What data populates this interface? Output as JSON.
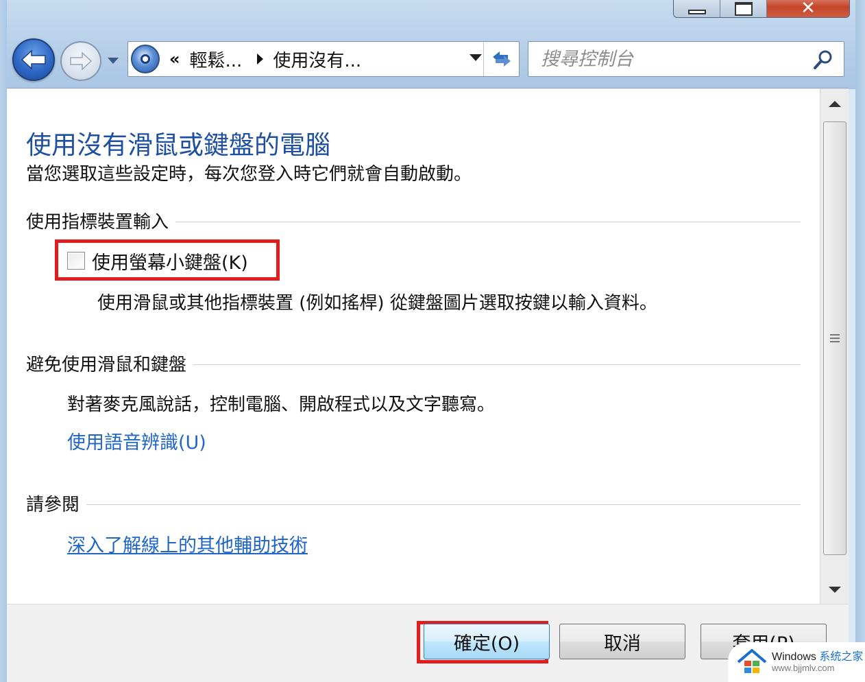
{
  "window": {
    "close_glyph": "✕"
  },
  "nav": {
    "back_label": "Back",
    "forward_label": "Forward"
  },
  "address": {
    "overflow": "«",
    "crumbs": [
      "輕鬆...",
      "使用沒有..."
    ]
  },
  "search": {
    "placeholder": "搜尋控制台"
  },
  "page": {
    "title": "使用沒有滑鼠或鍵盤的電腦",
    "description": "當您選取這些設定時，每次您登入時它們就會自動啟動。"
  },
  "sections": {
    "pointer": {
      "title": "使用指標裝置輸入",
      "checkbox_label": "使用螢幕小鍵盤(K)",
      "checkbox_checked": false,
      "description": "使用滑鼠或其他指標裝置 (例如搖桿) 從鍵盤圖片選取按鍵以輸入資料。"
    },
    "avoid": {
      "title": "避免使用滑鼠和鍵盤",
      "description": "對著麥克風說話，控制電腦、開啟程式以及文字聽寫。",
      "link": "使用語音辨識(U)"
    },
    "see_also": {
      "title": "請參閱",
      "link": "深入了解線上的其他輔助技術"
    }
  },
  "buttons": {
    "ok": "確定(O)",
    "cancel": "取消",
    "apply": "套用(P)"
  },
  "watermark": {
    "brand": "Windows",
    "brand_cn": "系统之家",
    "url": "www.bjjmlv.com"
  },
  "colors": {
    "title": "#1e4fa0",
    "link": "#1f66c7",
    "highlight": "#e21d1d"
  }
}
